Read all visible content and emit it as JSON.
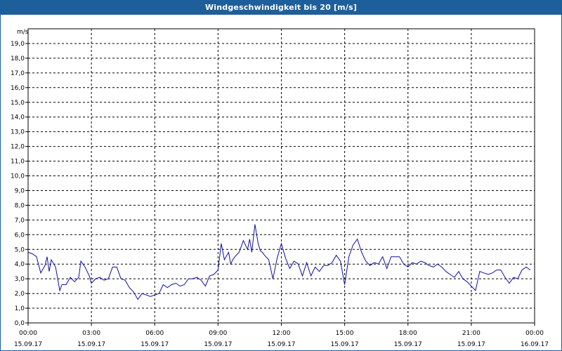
{
  "window": {
    "title": "Windgeschwindigkeit bis 20 [m/s]"
  },
  "chart_data": {
    "type": "line",
    "title": "Windgeschwindigkeit bis 20 [m/s]",
    "ylabel": "m/s",
    "xlabel": "",
    "ylim": [
      0,
      20
    ],
    "xlim_hours": [
      0,
      24
    ],
    "grid": true,
    "y_ticks": [
      "0,0",
      "1,0",
      "2,0",
      "3,0",
      "4,0",
      "5,0",
      "6,0",
      "7,0",
      "8,0",
      "9,0",
      "10,0",
      "11,0",
      "12,0",
      "13,0",
      "14,0",
      "15,0",
      "16,0",
      "17,0",
      "18,0",
      "19,0"
    ],
    "x_ticks": [
      {
        "time": "00:00",
        "date": "15.09.17"
      },
      {
        "time": "03:00",
        "date": "15.09.17"
      },
      {
        "time": "06:00",
        "date": "15.09.17"
      },
      {
        "time": "09:00",
        "date": "15.09.17"
      },
      {
        "time": "12:00",
        "date": "15.09.17"
      },
      {
        "time": "15:00",
        "date": "15.09.17"
      },
      {
        "time": "18:00",
        "date": "15.09.17"
      },
      {
        "time": "21:00",
        "date": "15.09.17"
      },
      {
        "time": "00:00",
        "date": "16.09.17"
      }
    ],
    "series": [
      {
        "color": "#1010a0",
        "x_hours": [
          0.0,
          0.2,
          0.4,
          0.6,
          0.8,
          0.9,
          1.0,
          1.1,
          1.3,
          1.5,
          1.6,
          1.8,
          2.0,
          2.2,
          2.4,
          2.5,
          2.7,
          2.9,
          3.0,
          3.2,
          3.4,
          3.6,
          3.8,
          4.0,
          4.2,
          4.4,
          4.6,
          4.8,
          5.0,
          5.2,
          5.4,
          5.6,
          5.8,
          6.0,
          6.2,
          6.4,
          6.6,
          6.8,
          7.0,
          7.2,
          7.4,
          7.6,
          7.8,
          8.0,
          8.2,
          8.4,
          8.6,
          8.8,
          9.0,
          9.15,
          9.3,
          9.5,
          9.6,
          9.7,
          9.8,
          10.0,
          10.2,
          10.4,
          10.5,
          10.6,
          10.75,
          10.9,
          11.0,
          11.1,
          11.2,
          11.4,
          11.6,
          11.8,
          12.0,
          12.2,
          12.4,
          12.6,
          12.8,
          13.0,
          13.2,
          13.4,
          13.6,
          13.8,
          14.0,
          14.2,
          14.4,
          14.6,
          14.8,
          15.0,
          15.2,
          15.4,
          15.6,
          15.8,
          16.0,
          16.2,
          16.4,
          16.6,
          16.8,
          17.0,
          17.2,
          17.4,
          17.6,
          17.8,
          18.0,
          18.2,
          18.4,
          18.6,
          18.8,
          19.0,
          19.2,
          19.4,
          19.6,
          19.8,
          20.0,
          20.2,
          20.4,
          20.6,
          20.8,
          21.0,
          21.2,
          21.4,
          21.6,
          21.8,
          22.0,
          22.2,
          22.4,
          22.6,
          22.8,
          23.0,
          23.2,
          23.4,
          23.6,
          23.8
        ],
        "values": [
          4.8,
          4.7,
          4.5,
          3.4,
          3.9,
          4.5,
          3.5,
          4.3,
          3.8,
          2.2,
          2.6,
          2.6,
          3.1,
          2.8,
          3.1,
          4.2,
          3.8,
          3.2,
          2.7,
          3.0,
          3.1,
          2.9,
          3.0,
          3.8,
          3.8,
          3.0,
          2.9,
          2.4,
          2.1,
          1.6,
          2.0,
          1.9,
          1.8,
          1.9,
          2.0,
          2.6,
          2.4,
          2.6,
          2.7,
          2.5,
          2.6,
          3.0,
          3.0,
          3.1,
          2.9,
          2.5,
          3.2,
          3.3,
          3.6,
          5.4,
          4.3,
          4.8,
          4.0,
          4.3,
          4.5,
          4.8,
          5.6,
          5.0,
          5.7,
          4.8,
          6.7,
          5.4,
          4.9,
          4.8,
          4.6,
          4.3,
          3.0,
          4.4,
          5.4,
          4.4,
          3.7,
          4.2,
          4.0,
          3.2,
          4.1,
          3.2,
          3.8,
          3.5,
          3.9,
          3.9,
          4.1,
          4.6,
          4.2,
          2.6,
          4.5,
          5.3,
          5.7,
          4.8,
          4.2,
          3.9,
          4.1,
          4.0,
          4.5,
          3.7,
          4.5,
          4.5,
          4.5,
          4.0,
          3.8,
          4.1,
          4.0,
          4.2,
          4.1,
          3.9,
          3.8,
          4.0,
          3.8,
          3.5,
          3.3,
          3.1,
          3.5,
          3.0,
          2.8,
          2.5,
          2.2,
          3.5,
          3.4,
          3.3,
          3.4,
          3.6,
          3.6,
          3.1,
          2.7,
          3.1,
          3.0,
          3.6,
          3.8,
          3.6,
          3.0,
          3.4,
          3.6
        ]
      }
    ]
  }
}
